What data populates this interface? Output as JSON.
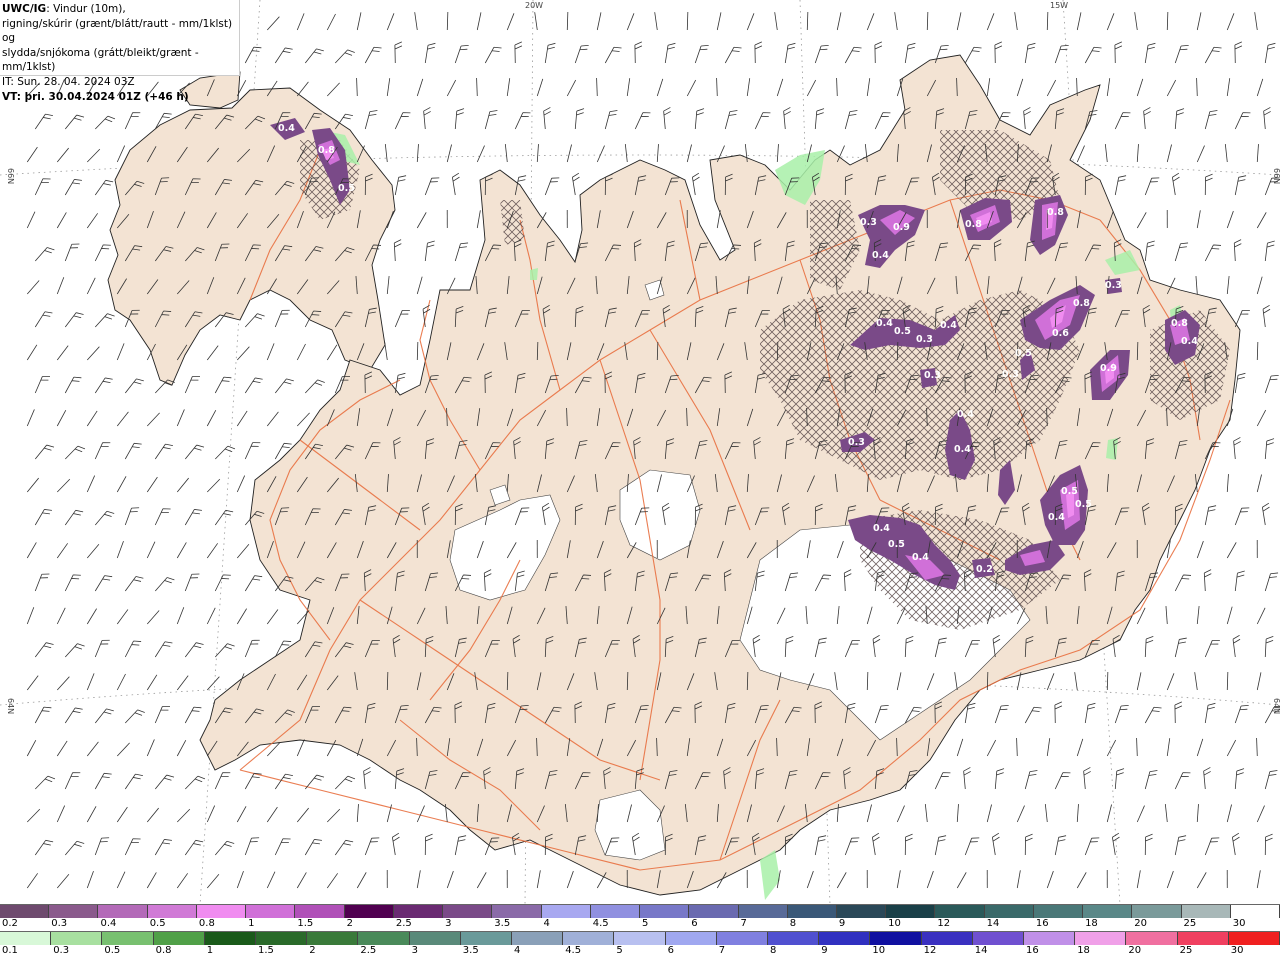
{
  "header": {
    "model": "UWC/IG",
    "line1_rest": ": Vindur (10m),",
    "line2": "rigning/skúrir (grænt/blátt/rautt - mm/1klst) og",
    "line3": "slydda/snjókoma (grátt/bleikt/grænt - mm/1klst)",
    "line4": "IT: Sun. 28. 04. 2024 03Z",
    "line5_label": "VT:",
    "line5_value": " þri. 30.04.2024 01Z (+46 h)"
  },
  "graticule": {
    "lon_20w": "20W",
    "lon_15w": "15W",
    "lat_66n_left": "66N",
    "lat_66n_right": "66N",
    "lat_64n_left": "64N",
    "lat_64n_right": "64N"
  },
  "precip_labels": [
    {
      "text": "0.4"
    },
    {
      "text": "0.8"
    },
    {
      "text": "0.5"
    },
    {
      "text": "0.3"
    },
    {
      "text": "0.9"
    },
    {
      "text": "0.4"
    },
    {
      "text": "0.8"
    },
    {
      "text": "0.8"
    },
    {
      "text": "0.3"
    },
    {
      "text": "0.4"
    },
    {
      "text": "0.5"
    },
    {
      "text": "0.3"
    },
    {
      "text": "0.4"
    },
    {
      "text": "0.8"
    },
    {
      "text": "0.6"
    },
    {
      "text": "0.5"
    },
    {
      "text": "0.9"
    },
    {
      "text": "0.8"
    },
    {
      "text": "0.4"
    },
    {
      "text": "0.3"
    },
    {
      "text": "0.3"
    },
    {
      "text": "0.4"
    },
    {
      "text": "0.3"
    },
    {
      "text": "0.4"
    },
    {
      "text": "0.5"
    },
    {
      "text": "0.4"
    },
    {
      "text": "0.2"
    },
    {
      "text": "0.5"
    },
    {
      "text": "0.4"
    },
    {
      "text": "0.5"
    },
    {
      "text": "0.4"
    }
  ],
  "legend_snow": {
    "labels": [
      "0.2",
      "0.3",
      "0.4",
      "0.5",
      "0.8",
      "1",
      "1.5",
      "2",
      "2.5",
      "3",
      "3.5",
      "4",
      "4.5",
      "5",
      "6",
      "7",
      "8",
      "9",
      "10",
      "12",
      "14",
      "16",
      "18",
      "20",
      "25",
      "30"
    ],
    "colors": [
      "#6e4a6e",
      "#8a5a8c",
      "#b36ab8",
      "#d07ad6",
      "#f08cf0",
      "#d070d8",
      "#b050b8",
      "#500050",
      "#6a2a72",
      "#7a4a88",
      "#8a6aa8",
      "#a8a8f0",
      "#9090e0",
      "#7878c8",
      "#6a6ab0",
      "#586a98",
      "#3a5878",
      "#2a4858",
      "#1a4048",
      "#2a5a5a",
      "#3a6a6a",
      "#4a7878",
      "#5a8888",
      "#7a9a9a",
      "#a8b8b8",
      "#ffffff"
    ]
  },
  "legend_rain": {
    "labels": [
      "0.1",
      "0.3",
      "0.5",
      "0.8",
      "1",
      "1.5",
      "2",
      "2.5",
      "3",
      "3.5",
      "4",
      "4.5",
      "5",
      "6",
      "7",
      "8",
      "9",
      "10",
      "12",
      "14",
      "16",
      "18",
      "20",
      "25",
      "30"
    ],
    "colors": [
      "#d8f8d8",
      "#a8e0a0",
      "#78c070",
      "#50a048",
      "#1a5a1a",
      "#2a6a2a",
      "#3a7a3a",
      "#4a8a5a",
      "#5a8a7a",
      "#6a9a9a",
      "#8aa0b8",
      "#a0b0d8",
      "#b8c0f0",
      "#a0a8f0",
      "#8080e0",
      "#5050d0",
      "#3030c0",
      "#1010a0",
      "#3a30c0",
      "#7050d0",
      "#c090e8",
      "#f0a0e8",
      "#f070a0",
      "#f04060",
      "#f02020"
    ]
  }
}
